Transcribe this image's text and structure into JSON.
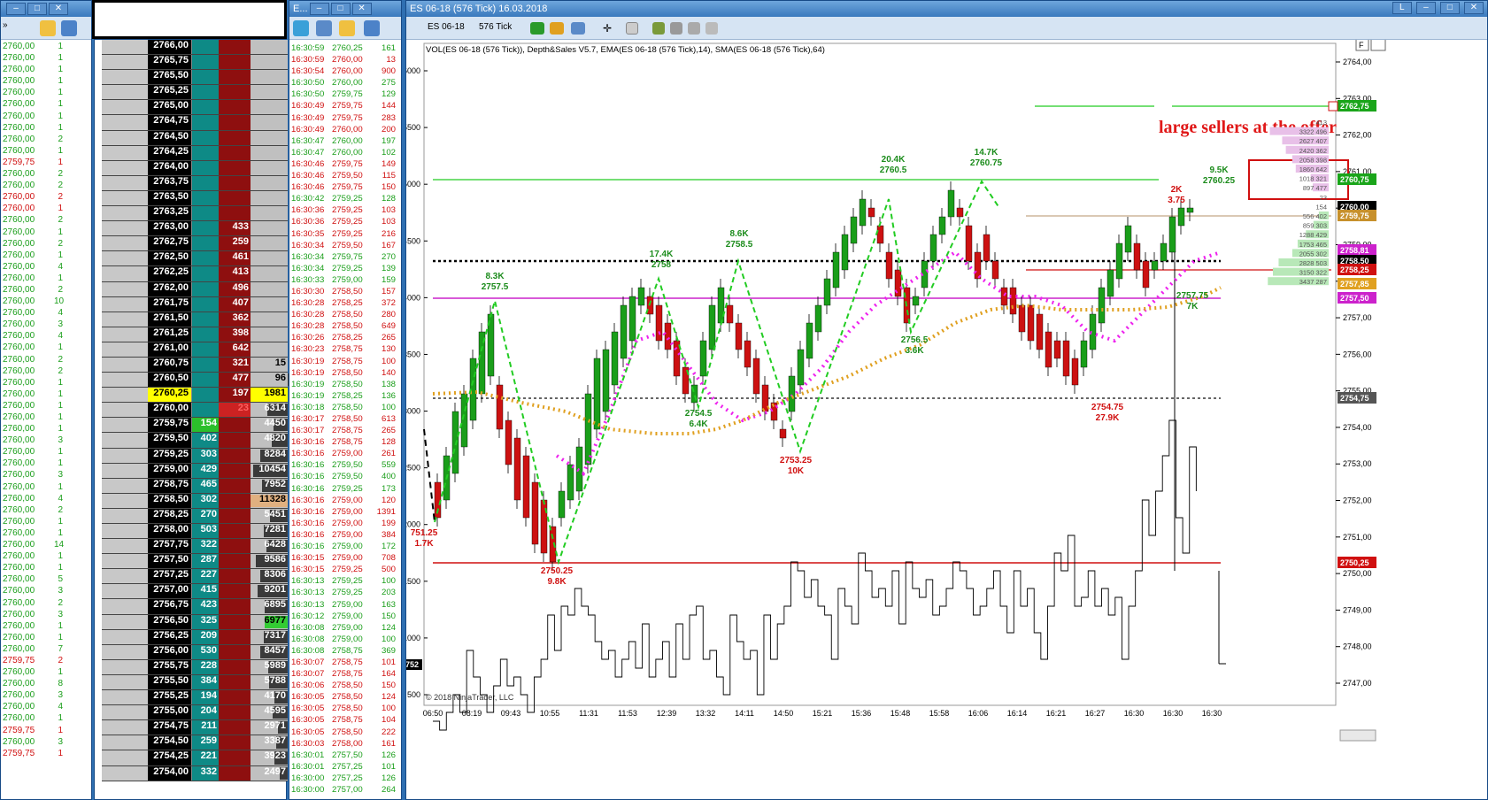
{
  "ts1_rows": [
    [
      "2760,00",
      "1"
    ],
    [
      "2760,00",
      "1"
    ],
    [
      "2760,00",
      "1"
    ],
    [
      "2760,00",
      "1"
    ],
    [
      "2760,00",
      "1"
    ],
    [
      "2760,00",
      "1"
    ],
    [
      "2760,00",
      "1"
    ],
    [
      "2760,00",
      "1"
    ],
    [
      "2760,00",
      "2"
    ],
    [
      "2760,00",
      "1"
    ],
    [
      "2759,75",
      "1"
    ],
    [
      "2760,00",
      "2"
    ],
    [
      "2760,00",
      "2"
    ],
    [
      "2760,00",
      "2"
    ],
    [
      "2760,00",
      "1"
    ],
    [
      "2760,00",
      "2"
    ],
    [
      "2760,00",
      "1"
    ],
    [
      "2760,00",
      "2"
    ],
    [
      "2760,00",
      "1"
    ],
    [
      "2760,00",
      "4"
    ],
    [
      "2760,00",
      "1"
    ],
    [
      "2760,00",
      "2"
    ],
    [
      "2760,00",
      "10"
    ],
    [
      "2760,00",
      "4"
    ],
    [
      "2760,00",
      "3"
    ],
    [
      "2760,00",
      "4"
    ],
    [
      "2760,00",
      "1"
    ],
    [
      "2760,00",
      "2"
    ],
    [
      "2760,00",
      "2"
    ],
    [
      "2760,00",
      "1"
    ],
    [
      "2760,00",
      "1"
    ],
    [
      "2760,00",
      "1"
    ],
    [
      "2760,00",
      "1"
    ],
    [
      "2760,00",
      "1"
    ],
    [
      "2760,00",
      "3"
    ],
    [
      "2760,00",
      "1"
    ],
    [
      "2760,00",
      "1"
    ],
    [
      "2760,00",
      "3"
    ],
    [
      "2760,00",
      "1"
    ],
    [
      "2760,00",
      "4"
    ],
    [
      "2760,00",
      "2"
    ],
    [
      "2760,00",
      "1"
    ],
    [
      "2760,00",
      "1"
    ],
    [
      "2760,00",
      "14"
    ],
    [
      "2760,00",
      "1"
    ],
    [
      "2760,00",
      "1"
    ],
    [
      "2760,00",
      "5"
    ],
    [
      "2760,00",
      "3"
    ],
    [
      "2760,00",
      "2"
    ],
    [
      "2760,00",
      "3"
    ],
    [
      "2760,00",
      "1"
    ],
    [
      "2760,00",
      "1"
    ],
    [
      "2760,00",
      "7"
    ],
    [
      "2759,75",
      "2"
    ],
    [
      "2760,00",
      "1"
    ],
    [
      "2760,00",
      "8"
    ],
    [
      "2760,00",
      "3"
    ],
    [
      "2760,00",
      "4"
    ],
    [
      "2760,00",
      "1"
    ],
    [
      "2759,75",
      "1"
    ],
    [
      "2760,00",
      "3"
    ],
    [
      "2759,75",
      "1"
    ]
  ],
  "ts1_red_idx": [
    10,
    13,
    14,
    53,
    59,
    61
  ],
  "ladder_rows": [
    [
      "2766,00",
      "",
      "",
      ""
    ],
    [
      "2765,75",
      "",
      "",
      ""
    ],
    [
      "2765,50",
      "",
      "",
      ""
    ],
    [
      "2765,25",
      "",
      "",
      ""
    ],
    [
      "2765,00",
      "",
      "",
      ""
    ],
    [
      "2764,75",
      "",
      "",
      ""
    ],
    [
      "2764,50",
      "",
      "",
      ""
    ],
    [
      "2764,25",
      "",
      "",
      ""
    ],
    [
      "2764,00",
      "",
      "",
      ""
    ],
    [
      "2763,75",
      "",
      "",
      ""
    ],
    [
      "2763,50",
      "",
      "",
      ""
    ],
    [
      "2763,25",
      "",
      "",
      ""
    ],
    [
      "2763,00",
      "",
      "433",
      ""
    ],
    [
      "2762,75",
      "",
      "259",
      ""
    ],
    [
      "2762,50",
      "",
      "461",
      ""
    ],
    [
      "2762,25",
      "",
      "413",
      ""
    ],
    [
      "2762,00",
      "",
      "496",
      ""
    ],
    [
      "2761,75",
      "",
      "407",
      ""
    ],
    [
      "2761,50",
      "",
      "362",
      ""
    ],
    [
      "2761,25",
      "",
      "398",
      ""
    ],
    [
      "2761,00",
      "",
      "642",
      ""
    ],
    [
      "2760,75",
      "",
      "321",
      "15"
    ],
    [
      "2760,50",
      "",
      "477",
      "96"
    ],
    [
      "2760,25",
      "",
      "197",
      "1981"
    ],
    [
      "2760,00",
      "",
      "23",
      "6314"
    ],
    [
      "2759,75",
      "154",
      "",
      "4450"
    ],
    [
      "2759,50",
      "402",
      "",
      "4820"
    ],
    [
      "2759,25",
      "303",
      "",
      "8284"
    ],
    [
      "2759,00",
      "429",
      "",
      "10454"
    ],
    [
      "2758,75",
      "465",
      "",
      "7952"
    ],
    [
      "2758,50",
      "302",
      "",
      "11328"
    ],
    [
      "2758,25",
      "270",
      "",
      "5451"
    ],
    [
      "2758,00",
      "503",
      "",
      "7281"
    ],
    [
      "2757,75",
      "322",
      "",
      "6428"
    ],
    [
      "2757,50",
      "287",
      "",
      "9586"
    ],
    [
      "2757,25",
      "227",
      "",
      "8306"
    ],
    [
      "2757,00",
      "415",
      "",
      "9201"
    ],
    [
      "2756,75",
      "423",
      "",
      "6895"
    ],
    [
      "2756,50",
      "325",
      "",
      "6977"
    ],
    [
      "2756,25",
      "209",
      "",
      "7317"
    ],
    [
      "2756,00",
      "530",
      "",
      "8457"
    ],
    [
      "2755,75",
      "228",
      "",
      "5989"
    ],
    [
      "2755,50",
      "384",
      "",
      "5788"
    ],
    [
      "2755,25",
      "194",
      "",
      "4170"
    ],
    [
      "2755,00",
      "204",
      "",
      "4595"
    ],
    [
      "2754,75",
      "211",
      "",
      "2971"
    ],
    [
      "2754,50",
      "259",
      "",
      "3387"
    ],
    [
      "2754,25",
      "221",
      "",
      "3923"
    ],
    [
      "2754,00",
      "332",
      "",
      "2497"
    ]
  ],
  "ts2_rows": [
    [
      "16:30:59",
      "2760,25",
      "161"
    ],
    [
      "16:30:59",
      "2760,00",
      "13"
    ],
    [
      "16:30:54",
      "2760,00",
      "900"
    ],
    [
      "16:30:50",
      "2760,00",
      "275"
    ],
    [
      "16:30:50",
      "2759,75",
      "129"
    ],
    [
      "16:30:49",
      "2759,75",
      "144"
    ],
    [
      "16:30:49",
      "2759,75",
      "283"
    ],
    [
      "16:30:49",
      "2760,00",
      "200"
    ],
    [
      "16:30:47",
      "2760,00",
      "197"
    ],
    [
      "16:30:47",
      "2760,00",
      "102"
    ],
    [
      "16:30:46",
      "2759,75",
      "149"
    ],
    [
      "16:30:46",
      "2759,50",
      "115"
    ],
    [
      "16:30:46",
      "2759,75",
      "150"
    ],
    [
      "16:30:42",
      "2759,25",
      "128"
    ],
    [
      "16:30:36",
      "2759,25",
      "103"
    ],
    [
      "16:30:36",
      "2759,25",
      "103"
    ],
    [
      "16:30:35",
      "2759,25",
      "216"
    ],
    [
      "16:30:34",
      "2759,50",
      "167"
    ],
    [
      "16:30:34",
      "2759,75",
      "270"
    ],
    [
      "16:30:34",
      "2759,25",
      "139"
    ],
    [
      "16:30:33",
      "2759,00",
      "159"
    ],
    [
      "16:30:30",
      "2758,50",
      "157"
    ],
    [
      "16:30:28",
      "2758,25",
      "372"
    ],
    [
      "16:30:28",
      "2758,50",
      "280"
    ],
    [
      "16:30:28",
      "2758,50",
      "649"
    ],
    [
      "16:30:26",
      "2758,25",
      "265"
    ],
    [
      "16:30:23",
      "2758,75",
      "130"
    ],
    [
      "16:30:19",
      "2758,75",
      "100"
    ],
    [
      "16:30:19",
      "2758,50",
      "140"
    ],
    [
      "16:30:19",
      "2758,50",
      "138"
    ],
    [
      "16:30:19",
      "2758,25",
      "136"
    ],
    [
      "16:30:18",
      "2758,50",
      "100"
    ],
    [
      "16:30:17",
      "2758,50",
      "613"
    ],
    [
      "16:30:17",
      "2758,75",
      "265"
    ],
    [
      "16:30:16",
      "2758,75",
      "128"
    ],
    [
      "16:30:16",
      "2759,00",
      "261"
    ],
    [
      "16:30:16",
      "2759,50",
      "559"
    ],
    [
      "16:30:16",
      "2759,50",
      "400"
    ],
    [
      "16:30:16",
      "2759,25",
      "173"
    ],
    [
      "16:30:16",
      "2759,00",
      "120"
    ],
    [
      "16:30:16",
      "2759,00",
      "1391"
    ],
    [
      "16:30:16",
      "2759,00",
      "199"
    ],
    [
      "16:30:16",
      "2759,00",
      "384"
    ],
    [
      "16:30:16",
      "2759,00",
      "172"
    ],
    [
      "16:30:15",
      "2759,00",
      "708"
    ],
    [
      "16:30:15",
      "2759,25",
      "500"
    ],
    [
      "16:30:13",
      "2759,25",
      "100"
    ],
    [
      "16:30:13",
      "2759,25",
      "203"
    ],
    [
      "16:30:13",
      "2759,00",
      "163"
    ],
    [
      "16:30:12",
      "2759,00",
      "150"
    ],
    [
      "16:30:08",
      "2759,00",
      "124"
    ],
    [
      "16:30:08",
      "2759,00",
      "100"
    ],
    [
      "16:30:08",
      "2758,75",
      "369"
    ],
    [
      "16:30:07",
      "2758,75",
      "101"
    ],
    [
      "16:30:07",
      "2758,75",
      "164"
    ],
    [
      "16:30:06",
      "2758,50",
      "150"
    ],
    [
      "16:30:05",
      "2758,50",
      "124"
    ],
    [
      "16:30:05",
      "2758,50",
      "100"
    ],
    [
      "16:30:05",
      "2758,75",
      "104"
    ],
    [
      "16:30:05",
      "2758,50",
      "222"
    ],
    [
      "16:30:03",
      "2758,00",
      "161"
    ],
    [
      "16:30:01",
      "2757,50",
      "126"
    ],
    [
      "16:30:01",
      "2757,25",
      "101"
    ],
    [
      "16:30:00",
      "2757,25",
      "126"
    ],
    [
      "16:30:00",
      "2757,00",
      "264"
    ]
  ],
  "ts2_red_idx": [
    1,
    2,
    5,
    6,
    7,
    10,
    11,
    12,
    14,
    15,
    16,
    17,
    21,
    22,
    23,
    24,
    25,
    26,
    27,
    28,
    32,
    33,
    34,
    35,
    39,
    40,
    41,
    42,
    44,
    45,
    53,
    54,
    55,
    56,
    57,
    58,
    59,
    60
  ],
  "ts2_green_idx": [
    0,
    3,
    4,
    8,
    9,
    13,
    18,
    19,
    20,
    29,
    30,
    31,
    36,
    37,
    38,
    43,
    46,
    47,
    48,
    49,
    50,
    51,
    52,
    61,
    62,
    63,
    64
  ],
  "chart": {
    "title": "ES 06-18 (576 Tick)  16.03.2018",
    "toolbar_instrument": "ES 06-18",
    "toolbar_interval": "576 Tick",
    "indicator_label": "VOL(ES 06-18 (576 Tick)), Depth&Sales V5.7, EMA(ES 06-18 (576 Tick),14), SMA(ES 06-18 (576 Tick),64)",
    "copyright": "© 2018 NinjaTrader, LLC",
    "annotation": "large sellers at the offer",
    "vol_axis": [
      "6000",
      "5500",
      "5000",
      "4500",
      "4000",
      "3500",
      "3000",
      "2500",
      "2000",
      "1500",
      "1000",
      "500"
    ],
    "price_axis": [
      "2764,00",
      "2763,00",
      "2762,00",
      "2761,00",
      "2760,00",
      "2759,00",
      "2758,00",
      "2757,00",
      "2756,00",
      "2755,00",
      "2754,00",
      "2753,00",
      "2752,00",
      "2751,00",
      "2750,00",
      "2749,00",
      "2748,00",
      "2747,00"
    ],
    "time_axis": [
      "06:50",
      "08:19",
      "09:43",
      "10:55",
      "11:31",
      "11:53",
      "12:39",
      "13:32",
      "14:11",
      "14:50",
      "15:21",
      "15:36",
      "15:48",
      "15:58",
      "16:06",
      "16:14",
      "16:21",
      "16:27",
      "16:30",
      "16:30",
      "16:30"
    ],
    "price_tags": [
      {
        "label": "2762,75",
        "color": "#1aa51a"
      },
      {
        "label": "2760,75",
        "color": "#1aa51a"
      },
      {
        "label": "2760,00",
        "color": "#000000"
      },
      {
        "label": "2759,75",
        "color": "#c7902c"
      },
      {
        "label": "2758,81",
        "color": "#cc22cc"
      },
      {
        "label": "2758,50",
        "color": "#000000"
      },
      {
        "label": "2758,25",
        "color": "#d01010"
      },
      {
        "label": "2757,85",
        "color": "#e0a020"
      },
      {
        "label": "2757,50",
        "color": "#cc22cc"
      },
      {
        "label": "2754,75",
        "color": "#555555"
      },
      {
        "label": "2750,25",
        "color": "#d01010"
      }
    ],
    "volume_tag": "752",
    "swing_labels": [
      {
        "text": "8.3K",
        "sub": "2757.5",
        "color": "#1c8c1c"
      },
      {
        "text": "17.4K",
        "sub": "2758",
        "color": "#1c8c1c"
      },
      {
        "text": "8.6K",
        "sub": "2758.5",
        "color": "#1c8c1c"
      },
      {
        "text": "20.4K",
        "sub": "2760.5",
        "color": "#1c8c1c"
      },
      {
        "text": "14.7K",
        "sub": "2760.75",
        "color": "#1c8c1c"
      },
      {
        "text": "9.5K",
        "sub": "2760.25",
        "color": "#1c8c1c"
      },
      {
        "text": "2K",
        "sub": "3.75",
        "color": "#d01010"
      },
      {
        "text": "751.25",
        "sub": "1.7K",
        "color": "#d01010"
      },
      {
        "text": "2750.25",
        "sub": "9.8K",
        "color": "#d01010"
      },
      {
        "text": "2754.5",
        "sub": "6.4K",
        "color": "#1c8c1c"
      },
      {
        "text": "2753.25",
        "sub": "10K",
        "color": "#d01010"
      },
      {
        "text": "2756.5",
        "sub": "3.6K",
        "color": "#1c8c1c"
      },
      {
        "text": "2754.75",
        "sub": "27.9K",
        "color": "#d01010"
      },
      {
        "text": "2757.75",
        "sub": "7K",
        "color": "#1c8c1c"
      }
    ],
    "depth_labels": [
      [
        "413"
      ],
      [
        "3322",
        "496"
      ],
      [
        "2627",
        "407"
      ],
      [
        "2420",
        "362"
      ],
      [
        "2058",
        "398"
      ],
      [
        "1860",
        "642"
      ],
      [
        "1018",
        "321"
      ],
      [
        "897",
        "477"
      ],
      [
        "23"
      ],
      [
        "154"
      ],
      [
        "556",
        "402"
      ],
      [
        "859",
        "303"
      ],
      [
        "1288",
        "429"
      ],
      [
        "1753",
        "465"
      ],
      [
        "2055",
        "302"
      ],
      [
        "2828",
        "503"
      ],
      [
        "3150",
        "322"
      ],
      [
        "3437",
        "287"
      ]
    ],
    "side_button": "F"
  }
}
